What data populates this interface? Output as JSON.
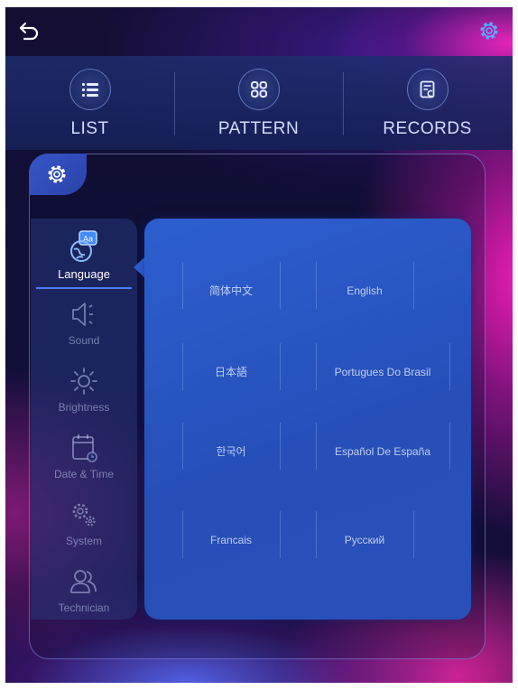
{
  "nav": {
    "tabs": [
      {
        "label": "LIST",
        "icon": "list-icon"
      },
      {
        "label": "PATTERN",
        "icon": "pattern-grid-icon"
      },
      {
        "label": "RECORDS",
        "icon": "records-icon"
      }
    ]
  },
  "settings": {
    "sidebar": [
      {
        "label": "Language",
        "icon": "language-icon",
        "active": true
      },
      {
        "label": "Sound",
        "icon": "speaker-icon"
      },
      {
        "label": "Brightness",
        "icon": "sun-icon"
      },
      {
        "label": "Date & Time",
        "icon": "calendar-icon"
      },
      {
        "label": "System",
        "icon": "system-gears-icon"
      },
      {
        "label": "Technician",
        "icon": "technician-icon"
      }
    ],
    "languages": [
      "简体中文",
      "English",
      "日本語",
      "Portugues Do Brasil",
      "한국어",
      "Español De España",
      "Francais",
      "Русский"
    ]
  },
  "colors": {
    "accent": "#4e7dff",
    "panel_blue": "#2d5fd0",
    "gear_accent": "#5aa8ff"
  }
}
